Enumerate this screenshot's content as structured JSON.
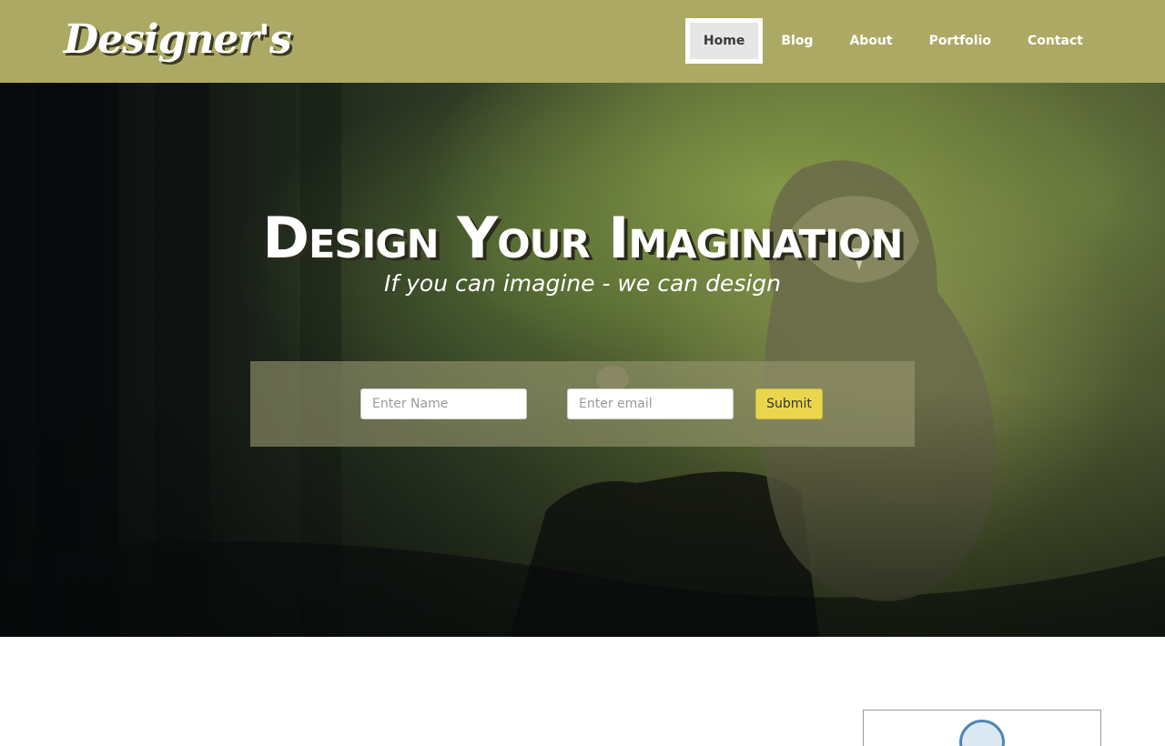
{
  "header": {
    "brand": "Designer's",
    "nav": [
      {
        "label": "Home",
        "active": true
      },
      {
        "label": "Blog",
        "active": false
      },
      {
        "label": "About",
        "active": false
      },
      {
        "label": "Portfolio",
        "active": false
      },
      {
        "label": "Contact",
        "active": false
      }
    ]
  },
  "hero": {
    "title": "Design Your Imagination",
    "subtitle": "If you can imagine - we can design",
    "form": {
      "name_placeholder": "Enter Name",
      "name_value": "",
      "email_placeholder": "Enter email",
      "email_value": "",
      "submit_label": "Submit"
    },
    "background_icon": "owl-forest-illustration"
  },
  "content": {
    "card_icon": "circle-logo-icon"
  },
  "colors": {
    "header_bg": "#aca964",
    "nav_active_bg": "#e6e6e6",
    "submit_bg": "#ead64c",
    "form_panel_bg": "#96966e"
  }
}
